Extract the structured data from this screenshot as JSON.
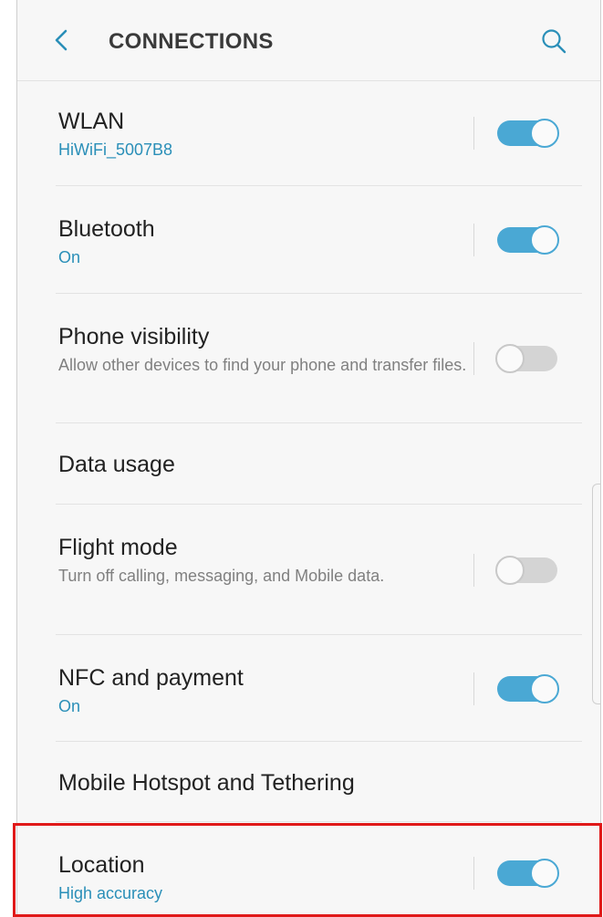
{
  "header": {
    "title": "CONNECTIONS",
    "back_icon": "chevron-left-icon",
    "search_icon": "search-icon"
  },
  "colors": {
    "accent": "#2a8fb8",
    "toggle_on": "#4aa8d4",
    "highlight": "#e01919"
  },
  "items": [
    {
      "title": "WLAN",
      "subtitle": "HiWiFi_5007B8",
      "toggle": "on"
    },
    {
      "title": "Bluetooth",
      "subtitle": "On",
      "toggle": "on"
    },
    {
      "title": "Phone visibility",
      "subtitle": "Allow other devices to find your phone and transfer files.",
      "toggle": "off"
    },
    {
      "title": "Data usage"
    },
    {
      "title": "Flight mode",
      "subtitle": "Turn off calling, messaging, and Mobile data.",
      "toggle": "off"
    },
    {
      "title": "NFC and payment",
      "subtitle": "On",
      "toggle": "on"
    },
    {
      "title": "Mobile Hotspot and Tethering"
    },
    {
      "title": "Location",
      "subtitle": "High accuracy",
      "toggle": "on"
    }
  ]
}
